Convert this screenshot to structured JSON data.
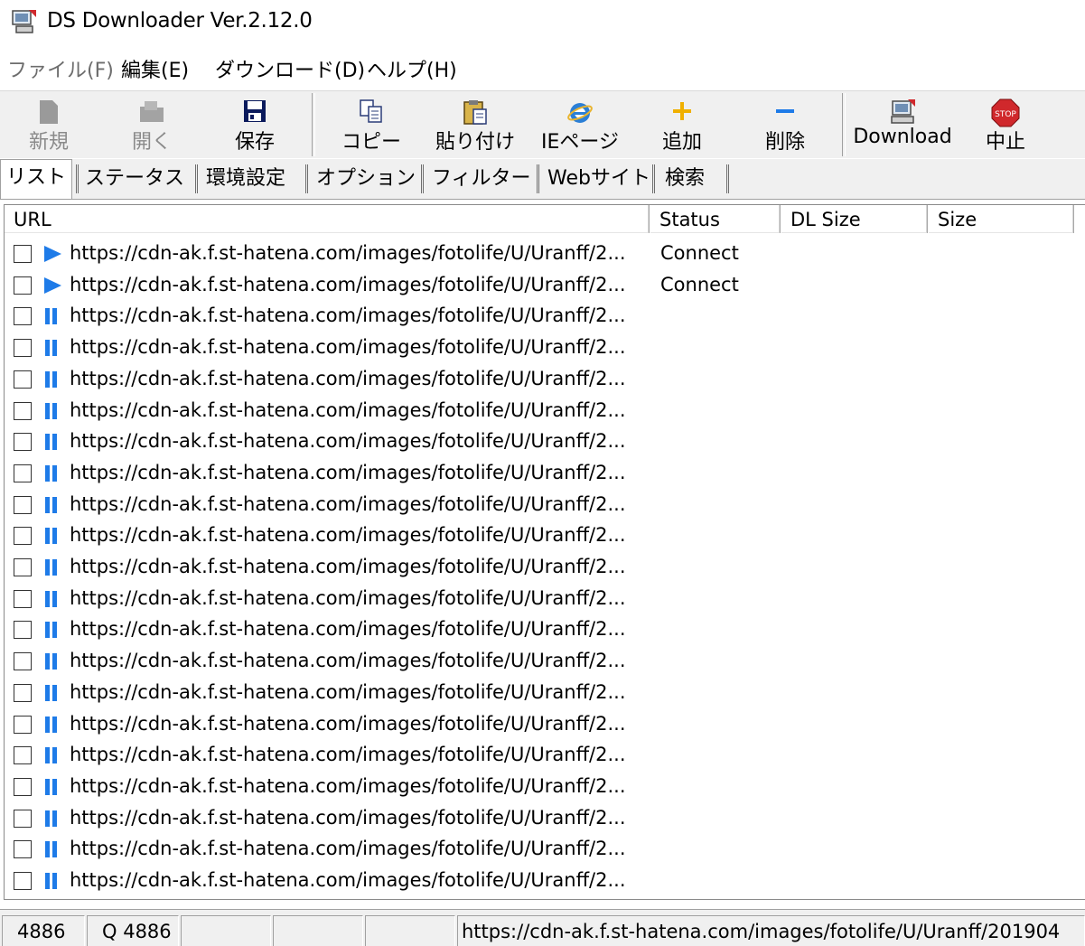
{
  "window": {
    "title": "DS Downloader Ver.2.12.0"
  },
  "menu": [
    {
      "label": "ファイル(F)",
      "disabled": true
    },
    {
      "label": "編集(E)",
      "disabled": false
    },
    {
      "label": "ダウンロード(D)",
      "disabled": false
    },
    {
      "label": "ヘルプ(H)",
      "disabled": false
    }
  ],
  "toolbar": {
    "new": {
      "label": "新規",
      "icon": "new-file-icon"
    },
    "open": {
      "label": "開く",
      "icon": "open-folder-icon"
    },
    "save": {
      "label": "保存",
      "icon": "floppy-disk-icon"
    },
    "copy": {
      "label": "コピー",
      "icon": "copy-icon"
    },
    "paste": {
      "label": "貼り付け",
      "icon": "paste-clipboard-icon"
    },
    "ie_page": {
      "label": "IEページ",
      "icon": "internet-explorer-icon"
    },
    "add": {
      "label": "追加",
      "icon": "plus-icon"
    },
    "delete": {
      "label": "削除",
      "icon": "minus-icon"
    },
    "download": {
      "label": "Download",
      "icon": "download-computer-icon"
    },
    "stop": {
      "label": "中止",
      "icon": "stop-sign-icon",
      "icon_text": "STOP"
    }
  },
  "tabs": [
    "リスト",
    "ステータス",
    "環境設定",
    "オプション",
    "フィルター",
    "Webサイト",
    "検索"
  ],
  "columns": {
    "url": "URL",
    "status": "Status",
    "dl_size": "DL Size",
    "size": "Size"
  },
  "rows": [
    {
      "state": "play",
      "url": "https://cdn-ak.f.st-hatena.com/images/fotolife/U/Uranff/2...",
      "status": "Connect"
    },
    {
      "state": "play",
      "url": "https://cdn-ak.f.st-hatena.com/images/fotolife/U/Uranff/2...",
      "status": "Connect"
    },
    {
      "state": "pause",
      "url": "https://cdn-ak.f.st-hatena.com/images/fotolife/U/Uranff/2...",
      "status": ""
    },
    {
      "state": "pause",
      "url": "https://cdn-ak.f.st-hatena.com/images/fotolife/U/Uranff/2...",
      "status": ""
    },
    {
      "state": "pause",
      "url": "https://cdn-ak.f.st-hatena.com/images/fotolife/U/Uranff/2...",
      "status": ""
    },
    {
      "state": "pause",
      "url": "https://cdn-ak.f.st-hatena.com/images/fotolife/U/Uranff/2...",
      "status": ""
    },
    {
      "state": "pause",
      "url": "https://cdn-ak.f.st-hatena.com/images/fotolife/U/Uranff/2...",
      "status": ""
    },
    {
      "state": "pause",
      "url": "https://cdn-ak.f.st-hatena.com/images/fotolife/U/Uranff/2...",
      "status": ""
    },
    {
      "state": "pause",
      "url": "https://cdn-ak.f.st-hatena.com/images/fotolife/U/Uranff/2...",
      "status": ""
    },
    {
      "state": "pause",
      "url": "https://cdn-ak.f.st-hatena.com/images/fotolife/U/Uranff/2...",
      "status": ""
    },
    {
      "state": "pause",
      "url": "https://cdn-ak.f.st-hatena.com/images/fotolife/U/Uranff/2...",
      "status": ""
    },
    {
      "state": "pause",
      "url": "https://cdn-ak.f.st-hatena.com/images/fotolife/U/Uranff/2...",
      "status": ""
    },
    {
      "state": "pause",
      "url": "https://cdn-ak.f.st-hatena.com/images/fotolife/U/Uranff/2...",
      "status": ""
    },
    {
      "state": "pause",
      "url": "https://cdn-ak.f.st-hatena.com/images/fotolife/U/Uranff/2...",
      "status": ""
    },
    {
      "state": "pause",
      "url": "https://cdn-ak.f.st-hatena.com/images/fotolife/U/Uranff/2...",
      "status": ""
    },
    {
      "state": "pause",
      "url": "https://cdn-ak.f.st-hatena.com/images/fotolife/U/Uranff/2...",
      "status": ""
    },
    {
      "state": "pause",
      "url": "https://cdn-ak.f.st-hatena.com/images/fotolife/U/Uranff/2...",
      "status": ""
    },
    {
      "state": "pause",
      "url": "https://cdn-ak.f.st-hatena.com/images/fotolife/U/Uranff/2...",
      "status": ""
    },
    {
      "state": "pause",
      "url": "https://cdn-ak.f.st-hatena.com/images/fotolife/U/Uranff/2...",
      "status": ""
    },
    {
      "state": "pause",
      "url": "https://cdn-ak.f.st-hatena.com/images/fotolife/U/Uranff/2...",
      "status": ""
    },
    {
      "state": "pause",
      "url": "https://cdn-ak.f.st-hatena.com/images/fotolife/U/Uranff/2...",
      "status": ""
    }
  ],
  "statusbar": {
    "count": "4886",
    "queue": "Q 4886",
    "panel3": "",
    "panel4": "",
    "panel5": "",
    "current_url": "https://cdn-ak.f.st-hatena.com/images/fotolife/U/Uranff/201904"
  },
  "colors": {
    "state_icon_blue": "#1e7be8",
    "stop_red": "#d0282c"
  }
}
